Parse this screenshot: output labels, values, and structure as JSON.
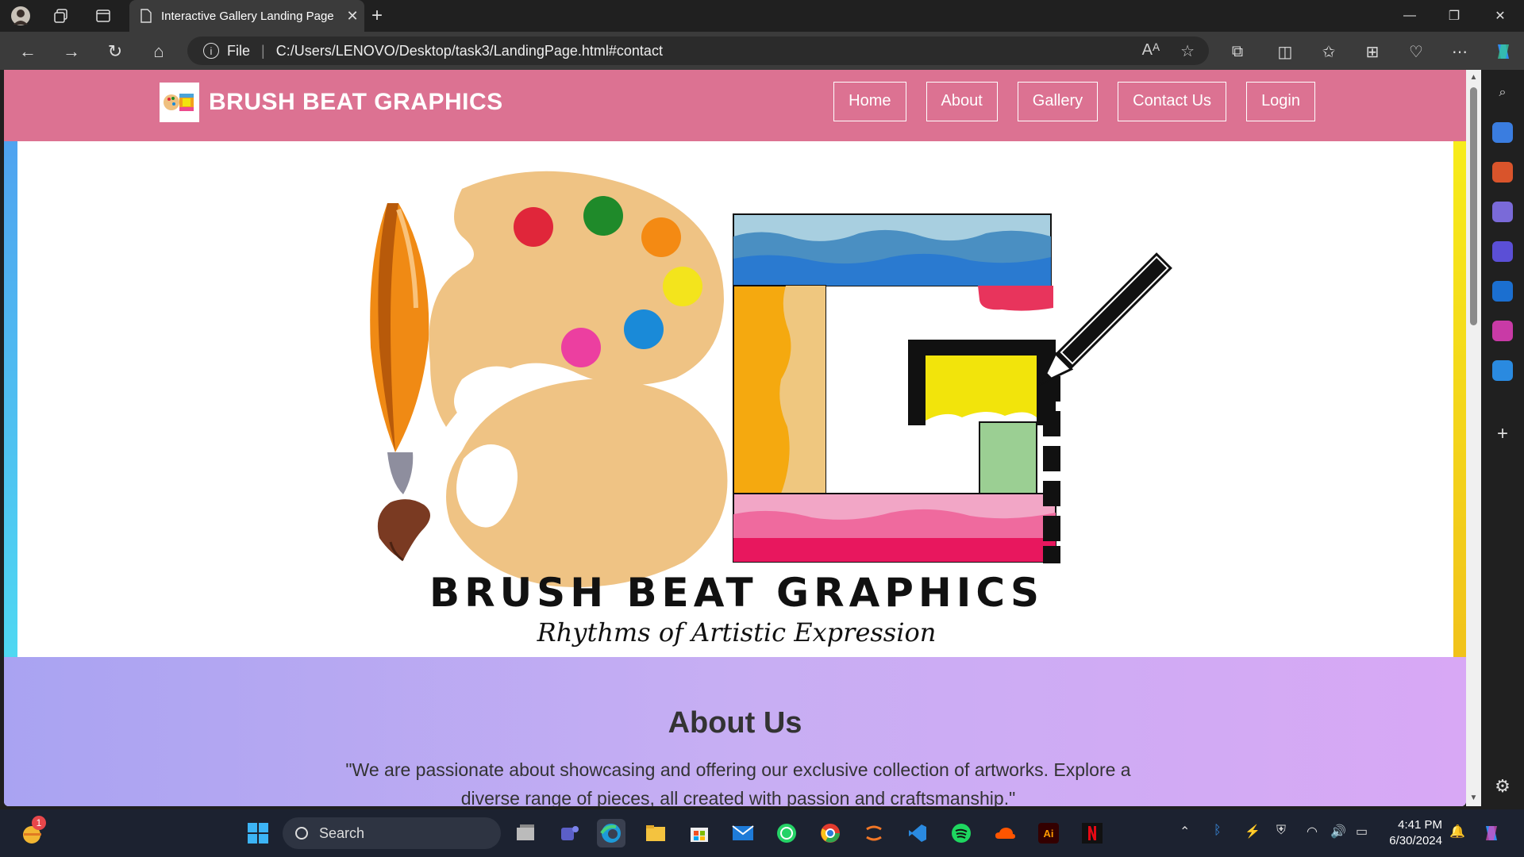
{
  "browser": {
    "tab_title": "Interactive Gallery Landing Page",
    "address": {
      "scheme_label": "File",
      "url": "C:/Users/LENOVO/Desktop/task3/LandingPage.html#contact"
    }
  },
  "site": {
    "brand": "BRUSH BEAT GRAPHICS",
    "nav": [
      "Home",
      "About",
      "Gallery",
      "Contact Us",
      "Login"
    ],
    "hero_logo": {
      "title": "BRUSH BEAT GRAPHICS",
      "tagline": "Rhythms of Artistic Expression"
    },
    "about": {
      "heading": "About Us",
      "text": "\"We are passionate about showcasing and offering our exclusive collection of artworks. Explore a diverse range of pieces, all created with passion and craftsmanship.\""
    },
    "colors": {
      "header": "#dc7292",
      "about_gradient_start": "#a9a3f2",
      "about_gradient_end": "#d8a8f5"
    }
  },
  "taskbar": {
    "search_placeholder": "Search",
    "time": "4:41 PM",
    "date": "6/30/2024",
    "weather_badge": "1"
  }
}
